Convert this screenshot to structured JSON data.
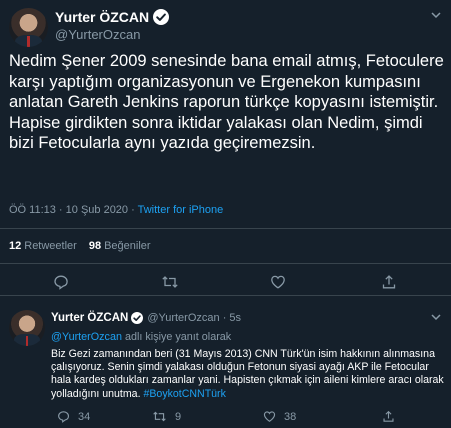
{
  "main_tweet": {
    "display_name": "Yurter ÖZCAN",
    "handle": "@YurterOzcan",
    "text": "Nedim Şener 2009 senesinde bana email atmış, Fetoculere karşı yaptığım organizasyonun ve Ergenekon kumpasını anlatan Gareth Jenkins raporun türkçe kopyasını istemiştir. Hapise girdikten sonra iktidar yalakası olan Nedim, şimdi bizi Fetocularla aynı yazıda geçiremezsin.",
    "timestamp": "ÖÖ 11:13 · 10 Şub 2020 ·",
    "source": "Twitter for iPhone",
    "retweets_count": "12",
    "retweets_label": "Retweetler",
    "likes_count": "98",
    "likes_label": "Beğeniler"
  },
  "reply_tweet": {
    "display_name": "Yurter ÖZCAN",
    "handle_time": "@YurterOzcan · 5s",
    "replying_mention": "@YurterOzcan",
    "replying_suffix": "adlı kişiye yanıt olarak",
    "text": "Biz Gezi zamanından beri (31 Mayıs 2013) CNN Türk'ün isim hakkının alınmasına çalışıyoruz. Senin şimdi yalakası olduğun Fetonun siyasi ayağı AKP ile Fetocular hala kardeş oldukları zamanlar yani. Hapisten çıkmak için aileni kimlere aracı olarak yolladığını unutma.",
    "hashtag": "#BoykotCNNTürk",
    "reply_count": "34",
    "retweet_count": "9",
    "like_count": "38"
  },
  "colors": {
    "background": "#15202b",
    "text": "#ffffff",
    "muted": "#8899a6",
    "link": "#1da1f2",
    "divider": "#38444d"
  },
  "icons": [
    "verified-badge-icon",
    "chevron-down-icon",
    "reply-icon",
    "retweet-icon",
    "like-icon",
    "share-icon"
  ]
}
